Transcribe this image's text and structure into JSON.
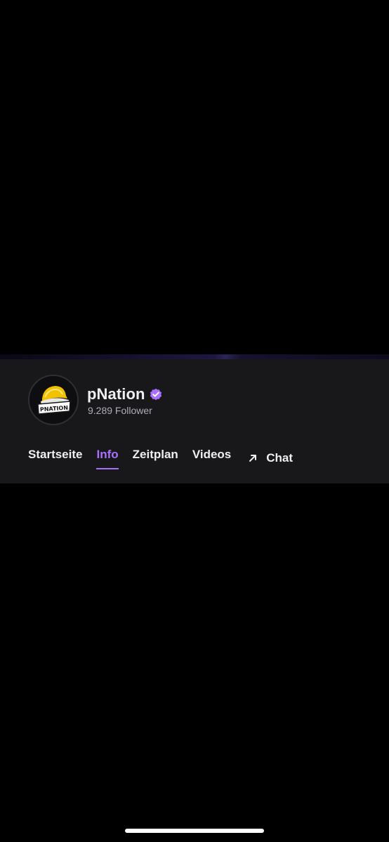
{
  "channel": {
    "name": "pNation",
    "followers": "9.289 Follower",
    "avatar_logo_text": "PNATION"
  },
  "tabs": [
    {
      "label": "Startseite",
      "active": false
    },
    {
      "label": "Info",
      "active": true
    },
    {
      "label": "Zeitplan",
      "active": false
    },
    {
      "label": "Videos",
      "active": false
    },
    {
      "label": "Chat",
      "active": false,
      "icon": "arrow-up-right-icon"
    }
  ],
  "colors": {
    "accent": "#a970ff",
    "header_bg": "#18181b",
    "text_primary": "#efeff1",
    "text_secondary": "#adadb8"
  },
  "icons": {
    "verified": "verified-badge-icon",
    "chat": "arrow-up-right-icon"
  }
}
